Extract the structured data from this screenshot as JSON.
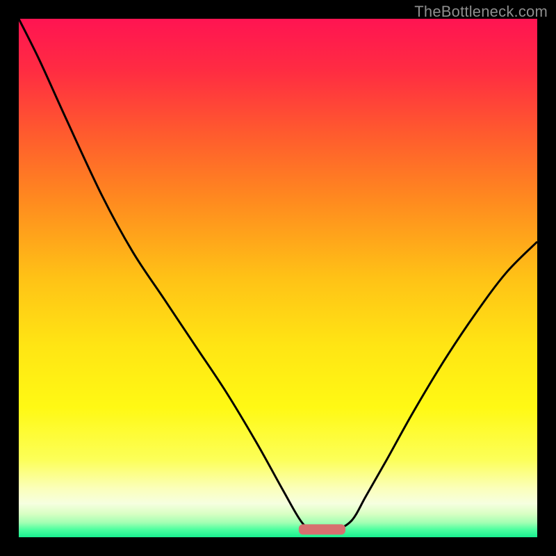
{
  "watermark": "TheBottleneck.com",
  "chart_data": {
    "type": "line",
    "title": "",
    "xlabel": "",
    "ylabel": "",
    "xlim": [
      0,
      100
    ],
    "ylim": [
      0,
      100
    ],
    "legend": false,
    "grid": false,
    "background_gradient": {
      "stops": [
        {
          "offset": 0.0,
          "color": "#ff1452"
        },
        {
          "offset": 0.1,
          "color": "#ff2c42"
        },
        {
          "offset": 0.22,
          "color": "#ff5a2e"
        },
        {
          "offset": 0.35,
          "color": "#ff8a1f"
        },
        {
          "offset": 0.5,
          "color": "#ffc216"
        },
        {
          "offset": 0.63,
          "color": "#ffe514"
        },
        {
          "offset": 0.75,
          "color": "#fff914"
        },
        {
          "offset": 0.85,
          "color": "#fcff58"
        },
        {
          "offset": 0.905,
          "color": "#fbffb9"
        },
        {
          "offset": 0.935,
          "color": "#f6ffe0"
        },
        {
          "offset": 0.955,
          "color": "#d8ffc3"
        },
        {
          "offset": 0.972,
          "color": "#a2ffb3"
        },
        {
          "offset": 0.985,
          "color": "#4effa0"
        },
        {
          "offset": 1.0,
          "color": "#18ef90"
        }
      ]
    },
    "series": [
      {
        "name": "bottleneck-curve",
        "color": "#000000",
        "width": 3,
        "x": [
          0.0,
          4.0,
          9.0,
          16.0,
          22.0,
          28.0,
          34.0,
          40.0,
          46.0,
          51.0,
          54.5,
          57.0,
          60.0,
          64.0,
          67.0,
          71.0,
          76.0,
          82.0,
          88.0,
          94.0,
          100.0
        ],
        "y": [
          100.0,
          92.0,
          81.0,
          66.0,
          55.0,
          46.0,
          37.0,
          28.0,
          18.0,
          9.0,
          3.0,
          1.0,
          1.0,
          3.0,
          8.0,
          15.0,
          24.0,
          34.0,
          43.0,
          51.0,
          57.0
        ]
      }
    ],
    "marker": {
      "name": "optimal-range",
      "shape": "rounded-bar",
      "color": "#d7706f",
      "x_center": 58.5,
      "width": 9.0,
      "y": 1.5,
      "height": 2.0
    }
  }
}
